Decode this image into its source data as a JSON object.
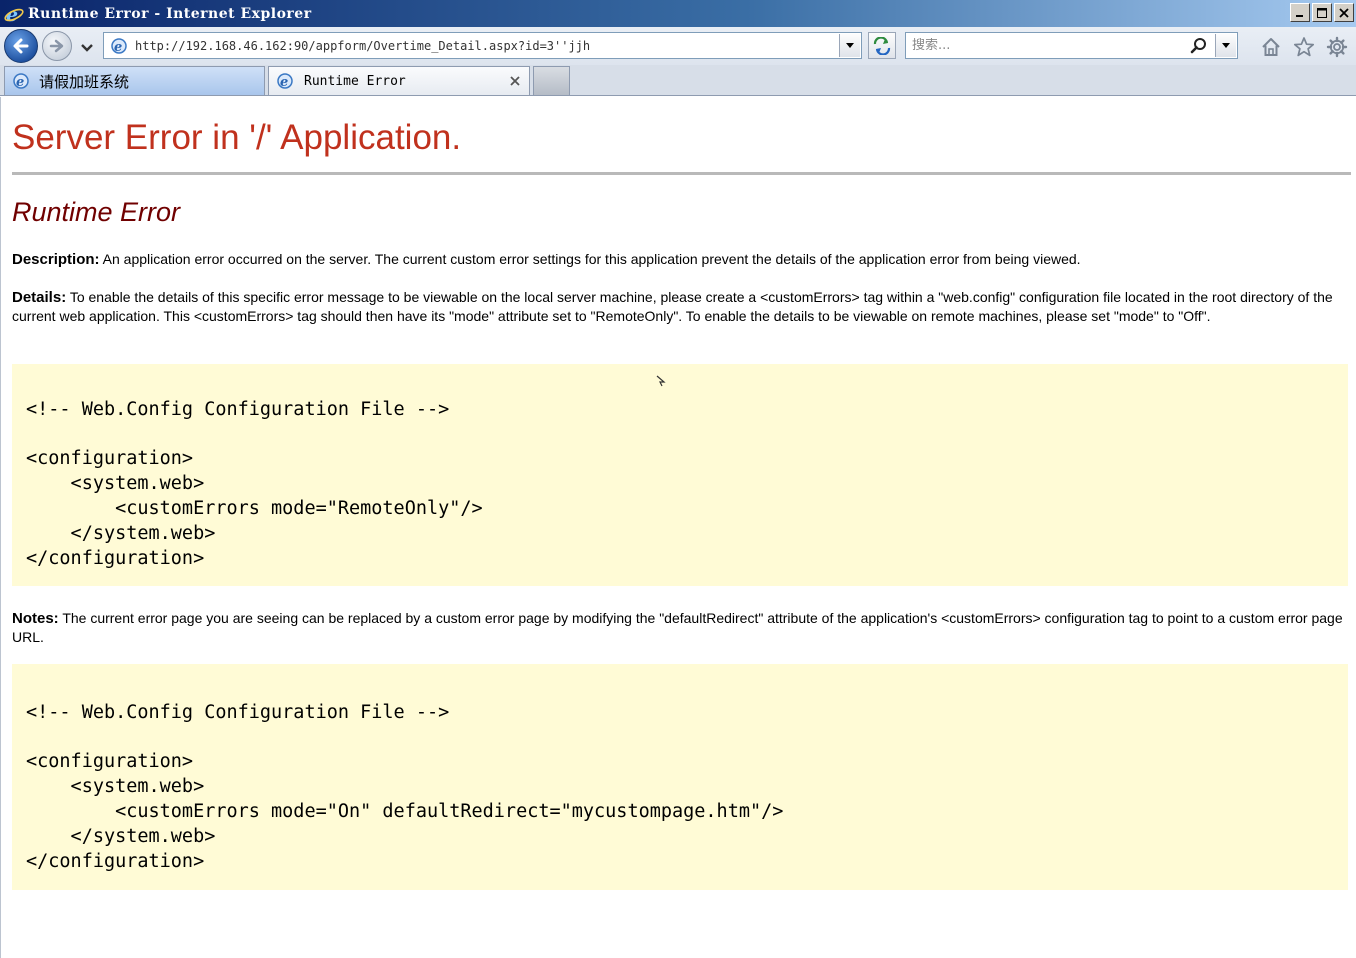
{
  "window": {
    "title": "Runtime Error - Internet Explorer"
  },
  "navigation": {
    "address": "http://192.168.46.162:90/appform/Overtime_Detail.aspx?id=3''jjh",
    "search_placeholder": "搜索..."
  },
  "tabs": [
    {
      "label": "请假加班系统",
      "active": false
    },
    {
      "label": "Runtime Error",
      "active": true
    }
  ],
  "page": {
    "title": "Server Error in '/' Application.",
    "subtitle": "Runtime Error",
    "description": {
      "label": "Description:",
      "text": "An application error occurred on the server. The current custom error settings for this application prevent the details of the application error from being viewed."
    },
    "details": {
      "label": "Details:",
      "text": "To enable the details of this specific error message to be viewable on the local server machine, please create a <customErrors> tag within a \"web.config\" configuration file located in the root directory of the current web application. This <customErrors> tag should then have its \"mode\" attribute set to \"RemoteOnly\". To enable the details to be viewable on remote machines, please set \"mode\" to \"Off\"."
    },
    "code_block_1": [
      "<!-- Web.Config Configuration File -->",
      "<configuration>",
      "    <system.web>",
      "        <customErrors mode=\"RemoteOnly\"/>",
      "    </system.web>",
      "</configuration>"
    ],
    "notes": {
      "label": "Notes:",
      "text": "The current error page you are seeing can be replaced by a custom error page by modifying the \"defaultRedirect\" attribute of the application's <customErrors> configuration tag to point to a custom error page URL."
    },
    "code_block_2": [
      "<!-- Web.Config Configuration File -->",
      "<configuration>",
      "    <system.web>",
      "        <customErrors mode=\"On\" defaultRedirect=\"mycustompage.htm\"/>",
      "    </system.web>",
      "</configuration>"
    ]
  },
  "colors": {
    "error_title": "#c0311d",
    "subtitle": "#700000",
    "code_background": "#fffbd6",
    "titlebar": "#0a246a"
  },
  "icons": {
    "titlebar": "ie-logo-icon",
    "back": "back-arrow-icon",
    "forward": "forward-arrow-icon",
    "refresh": "refresh-icon",
    "search": "search-icon",
    "home": "home-icon",
    "favorites": "star-icon",
    "tools": "gear-icon",
    "tab_close": "close-icon"
  }
}
